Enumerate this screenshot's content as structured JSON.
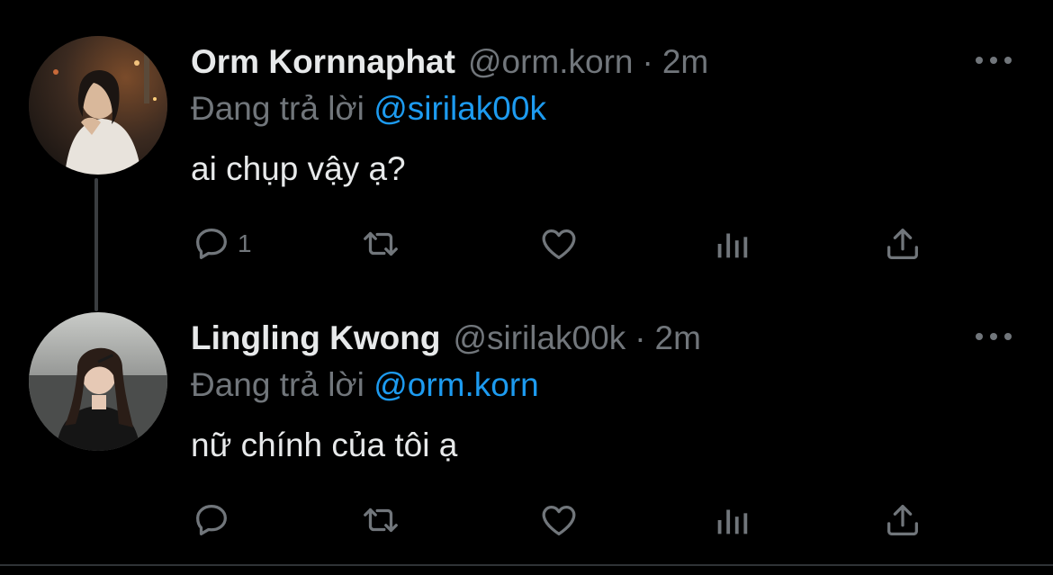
{
  "reply_prefix": "Đang trả lời",
  "tweets": [
    {
      "name": "Orm Kornnaphat",
      "handle": "@orm.korn",
      "separator": "·",
      "time": "2m",
      "reply_to": "@sirilak00k",
      "text": "ai chụp vậy ạ?",
      "reply_count": "1"
    },
    {
      "name": "Lingling Kwong",
      "handle": "@sirilak00k",
      "separator": "·",
      "time": "2m",
      "reply_to": "@orm.korn",
      "text": "nữ chính của tôi ạ",
      "reply_count": ""
    }
  ],
  "icons": {
    "reply": "reply-icon",
    "retweet": "retweet-icon",
    "like": "heart-icon",
    "views": "analytics-icon",
    "share": "share-icon",
    "more": "more-icon"
  },
  "colors": {
    "background": "#000000",
    "text": "#e7e9ea",
    "muted": "#71767b",
    "link": "#1d9bf0"
  }
}
